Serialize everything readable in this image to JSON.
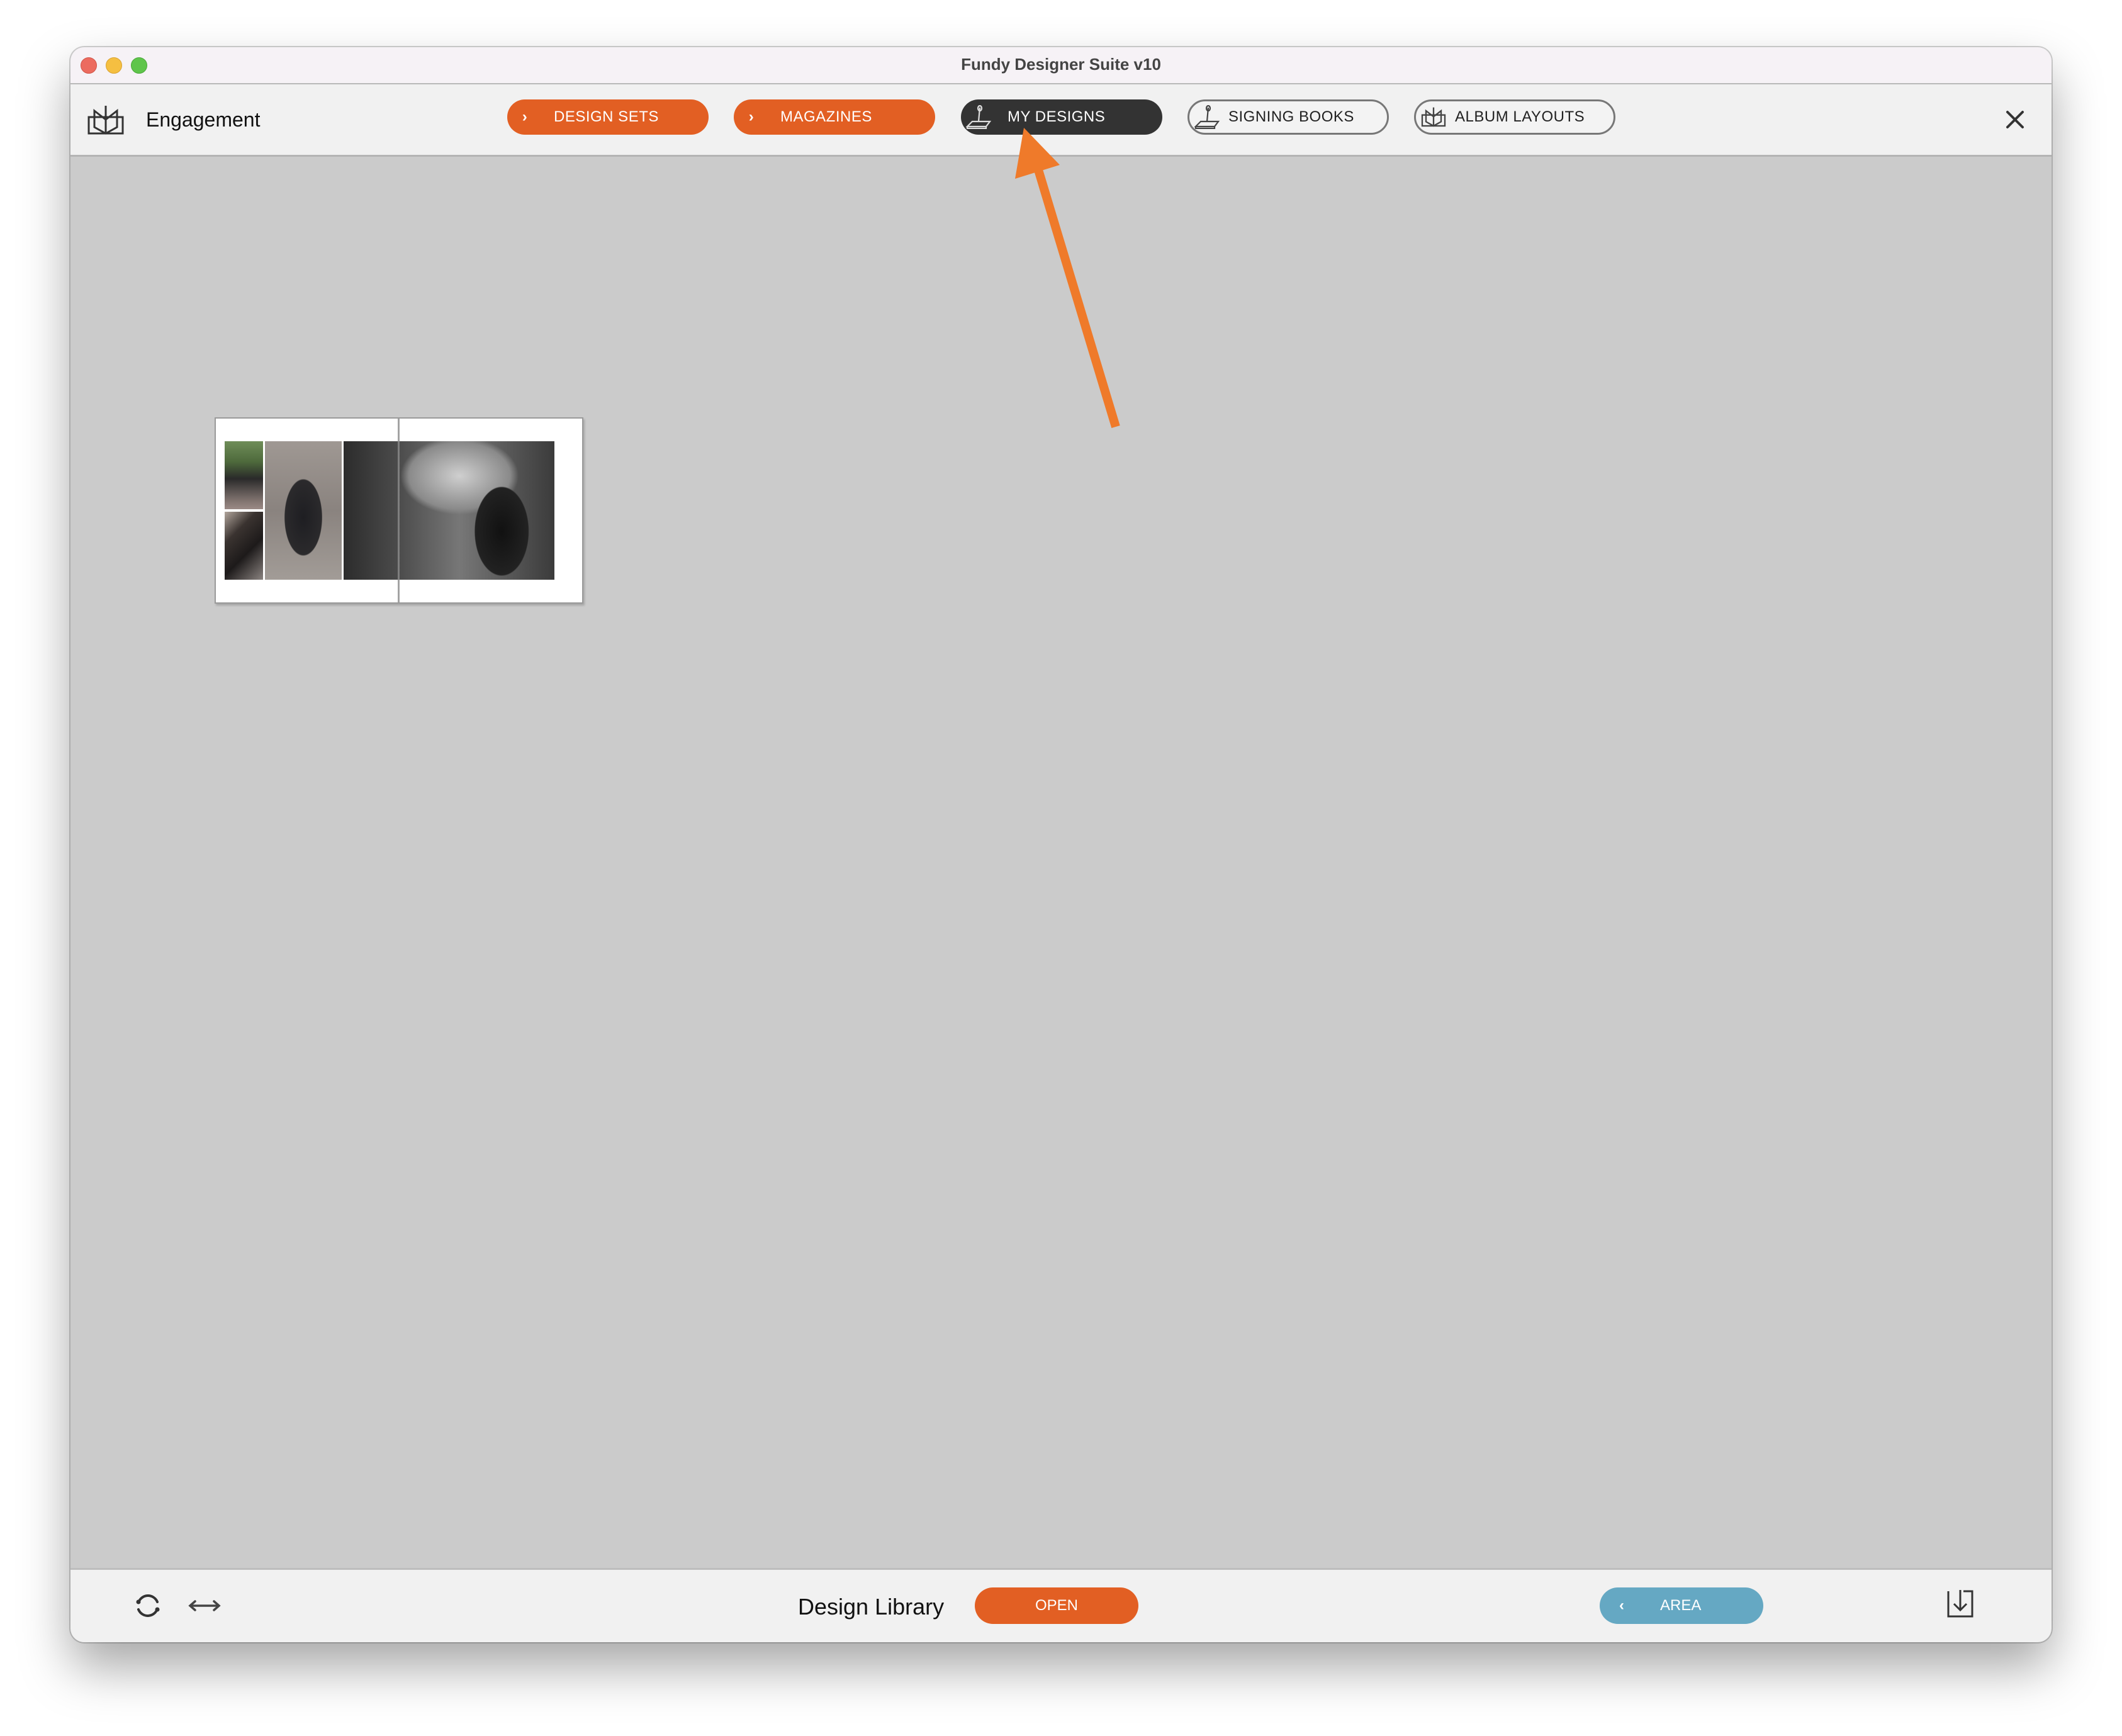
{
  "window": {
    "title": "Fundy Designer Suite v10",
    "traffic_lights": [
      "close",
      "minimize",
      "zoom"
    ]
  },
  "toolbar": {
    "project_icon": "album-book-icon",
    "project_name": "Engagement",
    "tabs": [
      {
        "label": "DESIGN SETS",
        "icon": "chevron-right-icon",
        "style": "orange"
      },
      {
        "label": "MAGAZINES",
        "icon": "chevron-right-icon",
        "style": "orange"
      },
      {
        "label": "MY DESIGNS",
        "icon": "signing-stamp-icon",
        "style": "dark",
        "active": true
      },
      {
        "label": "SIGNING BOOKS",
        "icon": "signing-stamp-icon",
        "style": "outline"
      },
      {
        "label": "ALBUM LAYOUTS",
        "icon": "album-book-icon",
        "style": "outline"
      }
    ],
    "close_icon": "close-icon"
  },
  "content": {
    "designs": [
      {
        "type": "album-spread-thumbnail",
        "photos": 4
      }
    ]
  },
  "annotation": {
    "type": "arrow",
    "color": "#ef7a2a",
    "points_to": "MY DESIGNS"
  },
  "bottom_bar": {
    "refresh_icon": "refresh-icon",
    "swap_icon": "horizontal-arrows-icon",
    "library_label": "Design Library",
    "open_label": "OPEN",
    "area_label": "AREA",
    "area_icon": "chevron-left-icon",
    "import_icon": "import-icon"
  },
  "colors": {
    "accent_orange": "#e25f23",
    "active_dark": "#333333",
    "area_blue": "#65a8c3",
    "canvas_gray": "#cbcbcb"
  }
}
